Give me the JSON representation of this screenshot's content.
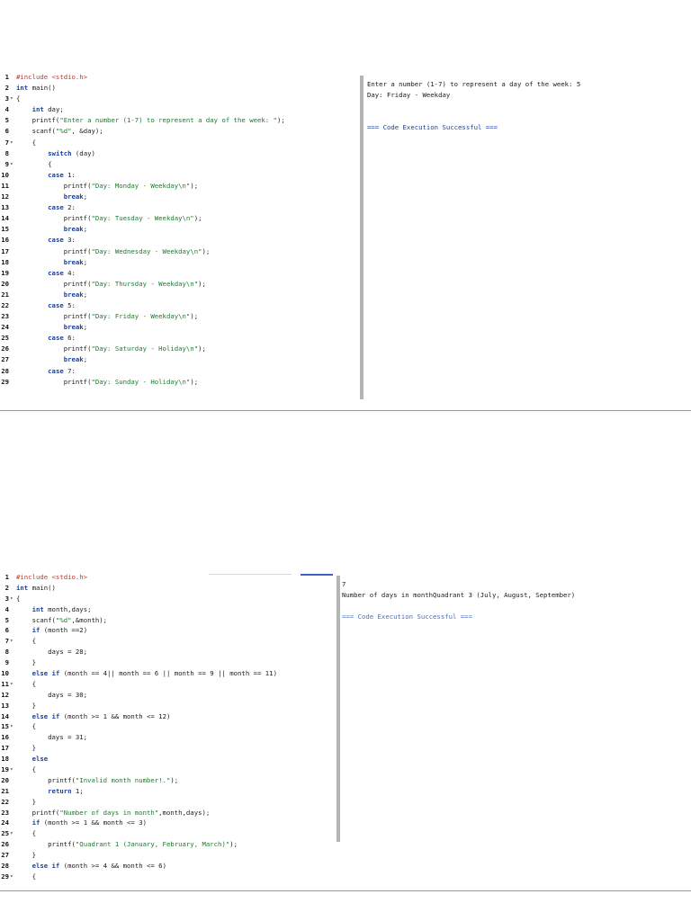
{
  "panel1": {
    "code_lines": [
      {
        "n": "1",
        "f": "",
        "c": [
          [
            "p",
            "#include <stdio.h>"
          ]
        ]
      },
      {
        "n": "2",
        "f": "",
        "c": [
          [
            "k",
            "int"
          ],
          [
            "n",
            " main()"
          ]
        ]
      },
      {
        "n": "3",
        "f": "▾",
        "c": [
          [
            "n",
            "{"
          ]
        ]
      },
      {
        "n": "4",
        "f": "",
        "c": [
          [
            "n",
            "    "
          ],
          [
            "k",
            "int"
          ],
          [
            "n",
            " day;"
          ]
        ]
      },
      {
        "n": "5",
        "f": "",
        "c": [
          [
            "n",
            "    printf("
          ],
          [
            "s",
            "\"Enter a number (1-7) to represent a day of the week: \""
          ],
          [
            "n",
            ");"
          ]
        ]
      },
      {
        "n": "6",
        "f": "",
        "c": [
          [
            "n",
            "    scanf("
          ],
          [
            "s",
            "\"%d\""
          ],
          [
            "n",
            ", &day);"
          ]
        ]
      },
      {
        "n": "7",
        "f": "▾",
        "c": [
          [
            "n",
            "    {"
          ]
        ]
      },
      {
        "n": "8",
        "f": "",
        "c": [
          [
            "n",
            "        "
          ],
          [
            "k",
            "switch"
          ],
          [
            "n",
            " (day)"
          ]
        ]
      },
      {
        "n": "9",
        "f": "▾",
        "c": [
          [
            "n",
            "        {"
          ]
        ]
      },
      {
        "n": "10",
        "f": "",
        "c": [
          [
            "n",
            "        "
          ],
          [
            "k",
            "case"
          ],
          [
            "n",
            " 1:"
          ]
        ]
      },
      {
        "n": "11",
        "f": "",
        "c": [
          [
            "n",
            "            printf("
          ],
          [
            "s",
            "\"Day: Monday - Weekday\\n\""
          ],
          [
            "n",
            ");"
          ]
        ]
      },
      {
        "n": "12",
        "f": "",
        "c": [
          [
            "n",
            "            "
          ],
          [
            "k",
            "break"
          ],
          [
            "n",
            ";"
          ]
        ]
      },
      {
        "n": "13",
        "f": "",
        "c": [
          [
            "n",
            "        "
          ],
          [
            "k",
            "case"
          ],
          [
            "n",
            " 2:"
          ]
        ]
      },
      {
        "n": "14",
        "f": "",
        "c": [
          [
            "n",
            "            printf("
          ],
          [
            "s",
            "\"Day: Tuesday - Weekday\\n\""
          ],
          [
            "n",
            ");"
          ]
        ]
      },
      {
        "n": "15",
        "f": "",
        "c": [
          [
            "n",
            "            "
          ],
          [
            "k",
            "break"
          ],
          [
            "n",
            ";"
          ]
        ]
      },
      {
        "n": "16",
        "f": "",
        "c": [
          [
            "n",
            "        "
          ],
          [
            "k",
            "case"
          ],
          [
            "n",
            " 3:"
          ]
        ]
      },
      {
        "n": "17",
        "f": "",
        "c": [
          [
            "n",
            "            printf("
          ],
          [
            "s",
            "\"Day: Wednesday - Weekday\\n\""
          ],
          [
            "n",
            ");"
          ]
        ]
      },
      {
        "n": "18",
        "f": "",
        "c": [
          [
            "n",
            "            "
          ],
          [
            "k",
            "break"
          ],
          [
            "n",
            ";"
          ]
        ]
      },
      {
        "n": "19",
        "f": "",
        "c": [
          [
            "n",
            "        "
          ],
          [
            "k",
            "case"
          ],
          [
            "n",
            " 4:"
          ]
        ]
      },
      {
        "n": "20",
        "f": "",
        "c": [
          [
            "n",
            "            printf("
          ],
          [
            "s",
            "\"Day: Thursday - Weekday\\n\""
          ],
          [
            "n",
            ");"
          ]
        ]
      },
      {
        "n": "21",
        "f": "",
        "c": [
          [
            "n",
            "            "
          ],
          [
            "k",
            "break"
          ],
          [
            "n",
            ";"
          ]
        ]
      },
      {
        "n": "22",
        "f": "",
        "c": [
          [
            "n",
            "        "
          ],
          [
            "k",
            "case"
          ],
          [
            "n",
            " 5:"
          ]
        ]
      },
      {
        "n": "23",
        "f": "",
        "c": [
          [
            "n",
            "            printf("
          ],
          [
            "s",
            "\"Day: Friday - Weekday\\n\""
          ],
          [
            "n",
            ");"
          ]
        ]
      },
      {
        "n": "24",
        "f": "",
        "c": [
          [
            "n",
            "            "
          ],
          [
            "k",
            "break"
          ],
          [
            "n",
            ";"
          ]
        ]
      },
      {
        "n": "25",
        "f": "",
        "c": [
          [
            "n",
            "        "
          ],
          [
            "k",
            "case"
          ],
          [
            "n",
            " 6:"
          ]
        ]
      },
      {
        "n": "26",
        "f": "",
        "c": [
          [
            "n",
            "            printf("
          ],
          [
            "s",
            "\"Day: Saturday - Holiday\\n\""
          ],
          [
            "n",
            ");"
          ]
        ]
      },
      {
        "n": "27",
        "f": "",
        "c": [
          [
            "n",
            "            "
          ],
          [
            "k",
            "break"
          ],
          [
            "n",
            ";"
          ]
        ]
      },
      {
        "n": "28",
        "f": "",
        "c": [
          [
            "n",
            "        "
          ],
          [
            "k",
            "case"
          ],
          [
            "n",
            " 7:"
          ]
        ]
      },
      {
        "n": "29",
        "f": "",
        "c": [
          [
            "n",
            "            printf("
          ],
          [
            "s",
            "\"Day: Sunday - Holiday\\n\""
          ],
          [
            "n",
            ");"
          ]
        ]
      }
    ],
    "output": {
      "prompt_line": "Enter a number (1-7) to represent a day of the week: 5",
      "result_line": "Day: Friday - Weekday",
      "status_line": "=== Code Execution Successful ==="
    }
  },
  "panel2": {
    "code_lines": [
      {
        "n": "1",
        "f": "",
        "c": [
          [
            "p",
            "#include <stdio.h>"
          ]
        ]
      },
      {
        "n": "2",
        "f": "",
        "c": [
          [
            "k",
            "int"
          ],
          [
            "n",
            " main()"
          ]
        ]
      },
      {
        "n": "3",
        "f": "▾",
        "c": [
          [
            "n",
            "{"
          ]
        ]
      },
      {
        "n": "4",
        "f": "",
        "c": [
          [
            "n",
            "    "
          ],
          [
            "k",
            "int"
          ],
          [
            "n",
            " month,days;"
          ]
        ]
      },
      {
        "n": "5",
        "f": "",
        "c": [
          [
            "n",
            "    scanf("
          ],
          [
            "s",
            "\"%d\""
          ],
          [
            "n",
            ",&month);"
          ]
        ]
      },
      {
        "n": "6",
        "f": "",
        "c": [
          [
            "n",
            "    "
          ],
          [
            "k",
            "if"
          ],
          [
            "n",
            " (month ==2)"
          ]
        ]
      },
      {
        "n": "7",
        "f": "▾",
        "c": [
          [
            "n",
            "    {"
          ]
        ]
      },
      {
        "n": "8",
        "f": "",
        "c": [
          [
            "n",
            "        days = 28;"
          ]
        ]
      },
      {
        "n": "9",
        "f": "",
        "c": [
          [
            "n",
            "    }"
          ]
        ]
      },
      {
        "n": "10",
        "f": "",
        "c": [
          [
            "n",
            "    "
          ],
          [
            "k",
            "else if"
          ],
          [
            "n",
            " (month == 4|| month == 6 || month == 9 || month == 11)"
          ]
        ]
      },
      {
        "n": "11",
        "f": "▾",
        "c": [
          [
            "n",
            "    {"
          ]
        ]
      },
      {
        "n": "12",
        "f": "",
        "c": [
          [
            "n",
            "        days = 30;"
          ]
        ]
      },
      {
        "n": "13",
        "f": "",
        "c": [
          [
            "n",
            "    }"
          ]
        ]
      },
      {
        "n": "14",
        "f": "",
        "c": [
          [
            "n",
            "    "
          ],
          [
            "k",
            "else if"
          ],
          [
            "n",
            " (month >= 1 && month <= 12)"
          ]
        ]
      },
      {
        "n": "15",
        "f": "▾",
        "c": [
          [
            "n",
            "    {"
          ]
        ]
      },
      {
        "n": "16",
        "f": "",
        "c": [
          [
            "n",
            "        days = 31;"
          ]
        ]
      },
      {
        "n": "17",
        "f": "",
        "c": [
          [
            "n",
            "    }"
          ]
        ]
      },
      {
        "n": "18",
        "f": "",
        "c": [
          [
            "n",
            "    "
          ],
          [
            "k",
            "else"
          ]
        ]
      },
      {
        "n": "19",
        "f": "▾",
        "c": [
          [
            "n",
            "    {"
          ]
        ]
      },
      {
        "n": "20",
        "f": "",
        "c": [
          [
            "n",
            "        printf("
          ],
          [
            "s",
            "\"Invalid month number!.\""
          ],
          [
            "n",
            ");"
          ]
        ]
      },
      {
        "n": "21",
        "f": "",
        "c": [
          [
            "n",
            "        "
          ],
          [
            "k",
            "return"
          ],
          [
            "n",
            " 1;"
          ]
        ]
      },
      {
        "n": "22",
        "f": "",
        "c": [
          [
            "n",
            "    }"
          ]
        ]
      },
      {
        "n": "23",
        "f": "",
        "c": [
          [
            "n",
            "    printf("
          ],
          [
            "s",
            "\"Number of days in month\""
          ],
          [
            "n",
            ",month,days);"
          ]
        ]
      },
      {
        "n": "24",
        "f": "",
        "c": [
          [
            "n",
            "    "
          ],
          [
            "k",
            "if"
          ],
          [
            "n",
            " (month >= 1 && month <= 3)"
          ]
        ]
      },
      {
        "n": "25",
        "f": "▾",
        "c": [
          [
            "n",
            "    {"
          ]
        ]
      },
      {
        "n": "26",
        "f": "",
        "c": [
          [
            "n",
            "        printf("
          ],
          [
            "s",
            "\"Quadrant 1 (January, February, March)\""
          ],
          [
            "n",
            ");"
          ]
        ]
      },
      {
        "n": "27",
        "f": "",
        "c": [
          [
            "n",
            "    }"
          ]
        ]
      },
      {
        "n": "28",
        "f": "",
        "c": [
          [
            "n",
            "    "
          ],
          [
            "k",
            "else if"
          ],
          [
            "n",
            " (month >= 4 && month <= 6)"
          ]
        ]
      },
      {
        "n": "29",
        "f": "▾",
        "c": [
          [
            "n",
            "    {"
          ]
        ]
      }
    ],
    "output": {
      "input_line": "7",
      "result_line": "Number of days in monthQuadrant 3 (July, August, September)",
      "status_line": "=== Code Execution Successful ==="
    }
  }
}
